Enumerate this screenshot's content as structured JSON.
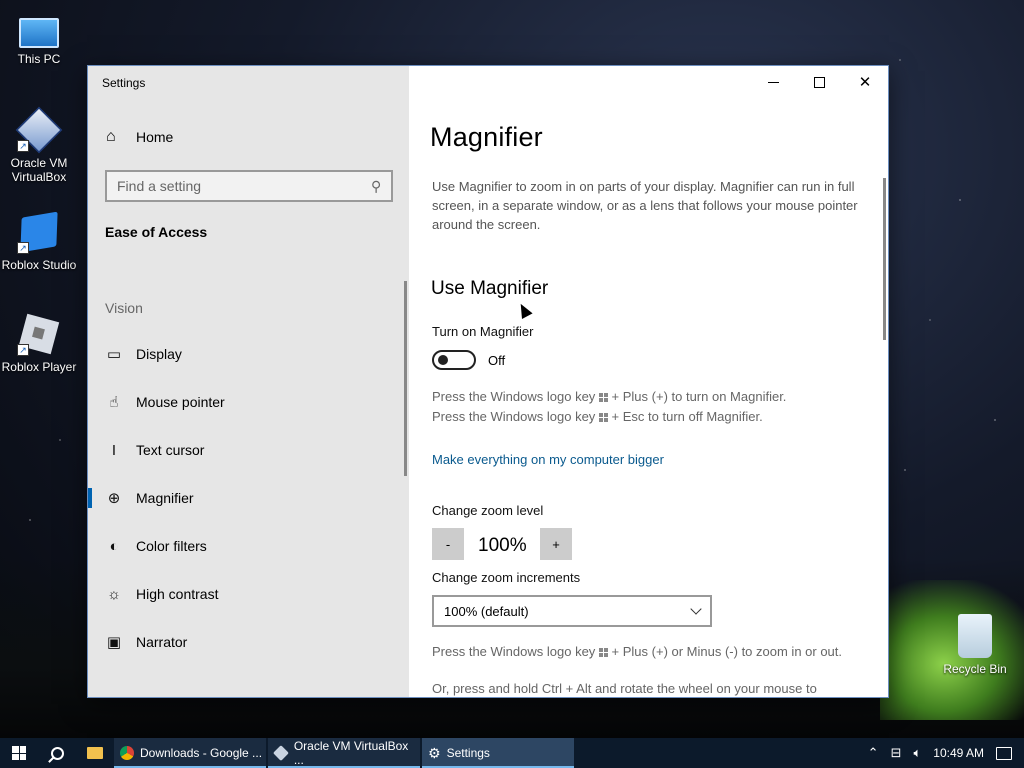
{
  "desktop": {
    "icons": [
      {
        "label": "This PC",
        "icon": "computer-icon"
      },
      {
        "label": "Oracle VM VirtualBox",
        "icon": "virtualbox-icon"
      },
      {
        "label": "Roblox Studio",
        "icon": "roblox-studio-icon"
      },
      {
        "label": "Roblox Player",
        "icon": "roblox-player-icon"
      },
      {
        "label": "Recycle Bin",
        "icon": "recycle-bin-icon"
      }
    ]
  },
  "window": {
    "title": "Settings",
    "controls": {
      "minimize": "minimize-icon",
      "maximize": "maximize-icon",
      "close": "close-icon"
    }
  },
  "sidebar": {
    "home_label": "Home",
    "search_placeholder": "Find a setting",
    "section_title": "Ease of Access",
    "group_label": "Vision",
    "items": [
      {
        "label": "Display",
        "icon": "display-icon",
        "active": false
      },
      {
        "label": "Mouse pointer",
        "icon": "mouse-pointer-icon",
        "active": false
      },
      {
        "label": "Text cursor",
        "icon": "text-cursor-icon",
        "active": false
      },
      {
        "label": "Magnifier",
        "icon": "magnifier-icon",
        "active": true
      },
      {
        "label": "Color filters",
        "icon": "color-filters-icon",
        "active": false
      },
      {
        "label": "High contrast",
        "icon": "high-contrast-icon",
        "active": false
      },
      {
        "label": "Narrator",
        "icon": "narrator-icon",
        "active": false
      }
    ]
  },
  "main": {
    "title": "Magnifier",
    "description": "Use Magnifier to zoom in on parts of your display. Magnifier can run in full screen, in a separate window, or as a lens that follows your mouse pointer around the screen.",
    "use_heading": "Use Magnifier",
    "toggle_label": "Turn on Magnifier",
    "toggle_state": "Off",
    "toggle_on": false,
    "hint_on_prefix": "Press the Windows logo key",
    "hint_on_suffix": "+ Plus (+) to turn on Magnifier.",
    "hint_off_prefix": "Press the Windows logo key",
    "hint_off_suffix": "+ Esc to turn off Magnifier.",
    "link_bigger": "Make everything on my computer bigger",
    "zoom_label": "Change zoom level",
    "zoom_minus": "-",
    "zoom_value": "100%",
    "zoom_plus": "+",
    "increments_label": "Change zoom increments",
    "increments_value": "100% (default)",
    "zoom_hint_prefix": "Press the Windows logo key",
    "zoom_hint_suffix": "+ Plus (+) or Minus (-) to zoom in or out.",
    "wheel_hint": "Or, press and hold Ctrl + Alt and rotate the wheel on your mouse to"
  },
  "taskbar": {
    "apps": [
      {
        "label": "Downloads - Google ...",
        "icon": "chrome-icon",
        "active": false
      },
      {
        "label": "Oracle VM VirtualBox ...",
        "icon": "virtualbox-icon",
        "active": false
      },
      {
        "label": "Settings",
        "icon": "gear-icon",
        "active": true
      }
    ],
    "time": "10:49 AM"
  }
}
